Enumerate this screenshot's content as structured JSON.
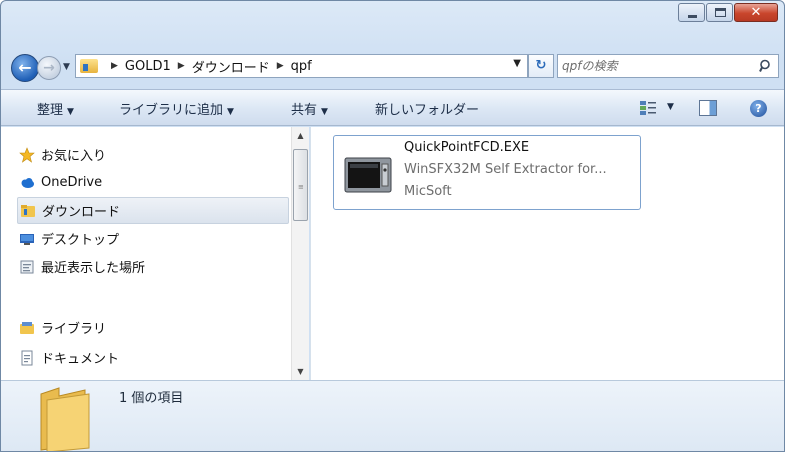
{
  "window": {
    "minimize_icon": "minimize-icon",
    "maximize_icon": "maximize-icon",
    "close_glyph": "✕"
  },
  "address_bar": {
    "breadcrumbs": [
      "GOLD1",
      "ダウンロード",
      "qpf"
    ],
    "folder_icon": "folder-icon"
  },
  "search": {
    "placeholder": "qpfの検索",
    "icon": "search-icon"
  },
  "command_bar": {
    "organize": "整理",
    "add_to_library": "ライブラリに追加",
    "share": "共有",
    "new_folder": "新しいフォルダー"
  },
  "nav_pane": {
    "items": [
      {
        "label": "お気に入り",
        "icon": "star-icon"
      },
      {
        "label": "OneDrive",
        "icon": "cloud-icon"
      },
      {
        "label": "ダウンロード",
        "icon": "download-folder-icon"
      },
      {
        "label": "デスクトップ",
        "icon": "desktop-icon"
      },
      {
        "label": "最近表示した場所",
        "icon": "recent-places-icon"
      },
      {
        "label": "ライブラリ",
        "icon": "library-icon"
      },
      {
        "label": "ドキュメント",
        "icon": "document-icon"
      }
    ],
    "selected_index": 2
  },
  "files": [
    {
      "name": "QuickPointFCD.EXE",
      "description": "WinSFX32M Self Extractor for...",
      "publisher": "MicSoft",
      "icon": "sfx-archive-icon"
    }
  ],
  "details": {
    "item_count_text": "1 個の項目"
  },
  "colors": {
    "accent": "#1f5fb6",
    "selection_border": "#7da2ce"
  }
}
